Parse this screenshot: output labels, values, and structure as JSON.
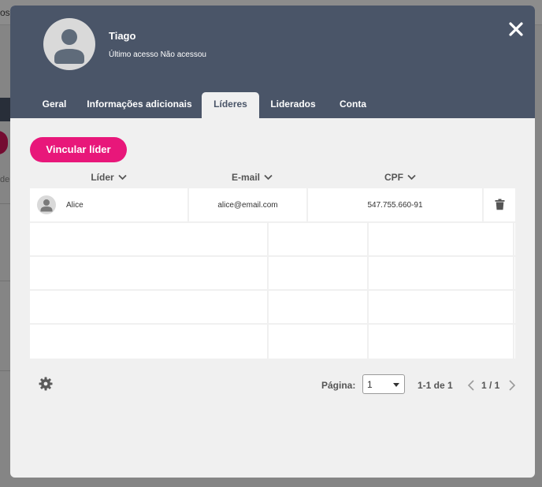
{
  "background": {
    "topbar_text": "os",
    "side_text": "de"
  },
  "header": {
    "user_name": "Tiago",
    "last_access": "Último acesso Não acessou"
  },
  "tabs": [
    {
      "label": "Geral",
      "active": false
    },
    {
      "label": "Informações adicionais",
      "active": false
    },
    {
      "label": "Líderes",
      "active": true
    },
    {
      "label": "Liderados",
      "active": false
    },
    {
      "label": "Conta",
      "active": false
    }
  ],
  "actions": {
    "link_leader_label": "Vincular líder"
  },
  "table": {
    "columns": [
      "Líder",
      "E-mail",
      "CPF"
    ],
    "rows": [
      {
        "name": "Alice",
        "email": "alice@email.com",
        "cpf": "547.755.660-91"
      }
    ]
  },
  "pagination": {
    "page_label": "Página:",
    "current_page": "1",
    "range": "1-1 de 1",
    "pages": "1 / 1"
  },
  "colors": {
    "header_bg": "#4a5568",
    "accent": "#e8177a",
    "modal_bg": "#f0f0f0"
  }
}
